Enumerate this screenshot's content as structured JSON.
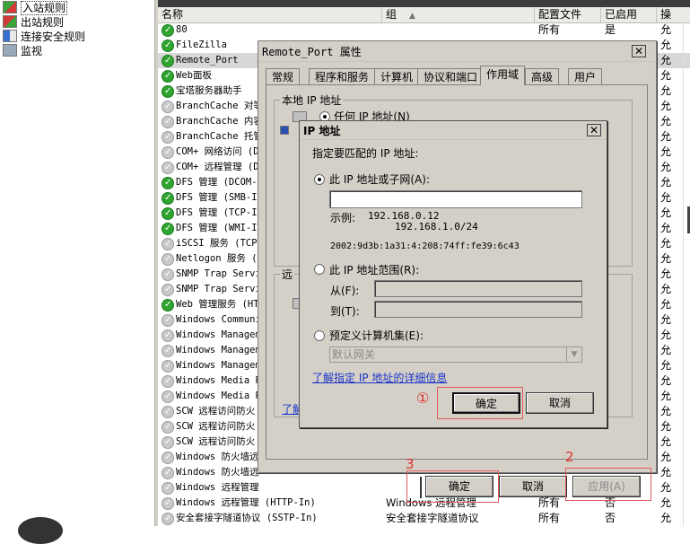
{
  "tree": {
    "items": [
      {
        "label": "入站规则",
        "icon": "inbound-rules-icon",
        "selected": true
      },
      {
        "label": "出站规则",
        "icon": "outbound-rules-icon",
        "selected": false
      },
      {
        "label": "连接安全规则",
        "icon": "connection-security-icon",
        "selected": false
      },
      {
        "label": "监视",
        "icon": "monitor-icon",
        "selected": false
      }
    ]
  },
  "list": {
    "headers": {
      "name": "名称",
      "group": "组",
      "profile": "配置文件",
      "enabled": "已启用",
      "action": "操"
    },
    "rows": [
      {
        "name": "80",
        "group": "",
        "profile": "所有",
        "enabled": "是",
        "action": "允",
        "on": true
      },
      {
        "name": "FileZilla",
        "group": "",
        "profile": "",
        "enabled": "",
        "action": "允",
        "on": true
      },
      {
        "name": "Remote_Port",
        "group": "",
        "profile": "",
        "enabled": "",
        "action": "允",
        "on": true,
        "selected": true
      },
      {
        "name": "Web面板",
        "group": "",
        "profile": "",
        "enabled": "",
        "action": "允",
        "on": true
      },
      {
        "name": "宝塔服务器助手",
        "group": "",
        "profile": "",
        "enabled": "",
        "action": "允",
        "on": true
      },
      {
        "name": "BranchCache 对等",
        "group": "",
        "profile": "",
        "enabled": "",
        "action": "允",
        "on": false
      },
      {
        "name": "BranchCache 内容",
        "group": "",
        "profile": "",
        "enabled": "",
        "action": "允",
        "on": false
      },
      {
        "name": "BranchCache 托管",
        "group": "",
        "profile": "",
        "enabled": "",
        "action": "允",
        "on": false
      },
      {
        "name": "COM+ 网络访问 (D",
        "group": "",
        "profile": "",
        "enabled": "",
        "action": "允",
        "on": false
      },
      {
        "name": "COM+ 远程管理 (D",
        "group": "",
        "profile": "",
        "enabled": "",
        "action": "允",
        "on": false
      },
      {
        "name": "DFS 管理 (DCOM-I",
        "group": "",
        "profile": "",
        "enabled": "",
        "action": "允",
        "on": true
      },
      {
        "name": "DFS 管理 (SMB-In",
        "group": "",
        "profile": "",
        "enabled": "",
        "action": "允",
        "on": true
      },
      {
        "name": "DFS 管理 (TCP-In",
        "group": "",
        "profile": "",
        "enabled": "",
        "action": "允",
        "on": true
      },
      {
        "name": "DFS 管理 (WMI-In",
        "group": "",
        "profile": "",
        "enabled": "",
        "action": "允",
        "on": true
      },
      {
        "name": "iSCSI 服务 (TCP-",
        "group": "",
        "profile": "",
        "enabled": "",
        "action": "允",
        "on": false
      },
      {
        "name": "Netlogon 服务 (N",
        "group": "",
        "profile": "",
        "enabled": "",
        "action": "允",
        "on": false
      },
      {
        "name": "SNMP Trap Servi",
        "group": "",
        "profile": "",
        "enabled": "",
        "action": "允",
        "on": false
      },
      {
        "name": "SNMP Trap Servi",
        "group": "",
        "profile": "",
        "enabled": "",
        "action": "允",
        "on": false
      },
      {
        "name": "Web 管理服务 (HT",
        "group": "",
        "profile": "",
        "enabled": "",
        "action": "允",
        "on": true
      },
      {
        "name": "Windows Communi",
        "group": "",
        "profile": "",
        "enabled": "",
        "action": "允",
        "on": false
      },
      {
        "name": "Windows Managem",
        "group": "",
        "profile": "",
        "enabled": "",
        "action": "允",
        "on": false
      },
      {
        "name": "Windows Managem",
        "group": "",
        "profile": "",
        "enabled": "",
        "action": "允",
        "on": false
      },
      {
        "name": "Windows Managem",
        "group": "",
        "profile": "",
        "enabled": "",
        "action": "允",
        "on": false
      },
      {
        "name": "Windows Media P",
        "group": "",
        "profile": "",
        "enabled": "",
        "action": "允",
        "on": false
      },
      {
        "name": "Windows Media P",
        "group": "",
        "profile": "",
        "enabled": "",
        "action": "允",
        "on": false
      },
      {
        "name": "SCW 远程访问防火",
        "group": "",
        "profile": "",
        "enabled": "",
        "action": "允",
        "on": false
      },
      {
        "name": "SCW 远程访问防火",
        "group": "",
        "profile": "",
        "enabled": "",
        "action": "允",
        "on": false
      },
      {
        "name": "SCW 远程访问防火",
        "group": "",
        "profile": "",
        "enabled": "",
        "action": "允",
        "on": false
      },
      {
        "name": "Windows 防火墙远",
        "group": "",
        "profile": "",
        "enabled": "",
        "action": "允",
        "on": false
      },
      {
        "name": "Windows 防火墙远",
        "group": "",
        "profile": "",
        "enabled": "",
        "action": "允",
        "on": false
      },
      {
        "name": "Windows 远程管理",
        "group": "",
        "profile": "",
        "enabled": "",
        "action": "允",
        "on": false
      },
      {
        "name": "Windows 远程管理 (HTTP-In)",
        "group": "Windows 远程管理",
        "profile": "所有",
        "enabled": "否",
        "action": "允",
        "on": false
      },
      {
        "name": "安全套接字隧道协议 (SSTP-In)",
        "group": "安全套接字隧道协议",
        "profile": "所有",
        "enabled": "否",
        "action": "允",
        "on": false
      }
    ]
  },
  "prop_dialog": {
    "title": "Remote_Port 属性",
    "tabs": [
      "常规",
      "程序和服务",
      "计算机",
      "协议和端口",
      "作用域",
      "高级",
      "用户"
    ],
    "active_tab": "作用域",
    "local_ip_group": "本地 IP 地址",
    "local_any": "任何 IP 地址(N)",
    "remote_group": "远",
    "link_partial": "了解",
    "ok": "确定",
    "cancel": "取消",
    "apply": "应用(A)"
  },
  "ip_dialog": {
    "title": "IP 地址",
    "instruction": "指定要匹配的 IP 地址:",
    "opt1": "此 IP 地址或子网(A):",
    "opt1_value": "",
    "example_label": "示例:",
    "example1": "192.168.0.12",
    "example2": "192.168.1.0/24",
    "example3": "2002:9d3b:1a31:4:208:74ff:fe39:6c43",
    "opt2": "此 IP 地址范围(R):",
    "from_label": "从(F):",
    "to_label": "到(T):",
    "opt3": "预定义计算机集(E):",
    "predefined_value": "默认网关",
    "link": "了解指定 IP 地址的详细信息",
    "ok": "确定",
    "cancel": "取消"
  },
  "annotations": {
    "one": "①",
    "two": "2",
    "three": "3",
    "color": "#e03030"
  }
}
